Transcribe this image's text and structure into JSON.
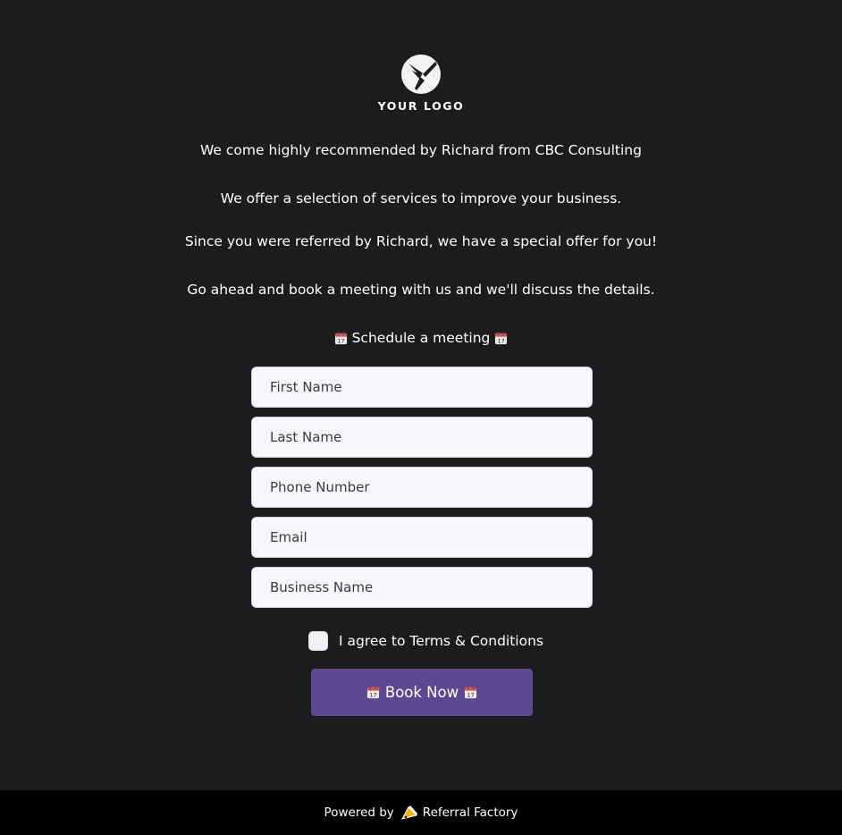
{
  "logo": {
    "text": "YOUR LOGO"
  },
  "intro": {
    "line1": "We come highly recommended by Richard from CBC Consulting",
    "line2": "We offer a selection of services to improve your business.",
    "line3": "Since you were referred by Richard, we have a special offer for you!",
    "line4": "Go ahead and book a meeting with us and we'll discuss the details."
  },
  "schedule": {
    "label": "Schedule a meeting",
    "icon": "calendar-icon"
  },
  "form": {
    "first_name_placeholder": "First Name",
    "last_name_placeholder": "Last Name",
    "phone_placeholder": "Phone Number",
    "email_placeholder": "Email",
    "business_placeholder": "Business Name",
    "terms_label": "I agree to Terms & Conditions",
    "terms_checked": false,
    "submit_label": "Book Now"
  },
  "footer": {
    "powered_by": "Powered by",
    "brand": "Referral Factory"
  },
  "colors": {
    "background": "#1c1b1d",
    "button": "#5e4791",
    "field": "#f7f6fb",
    "footer": "#000000"
  }
}
